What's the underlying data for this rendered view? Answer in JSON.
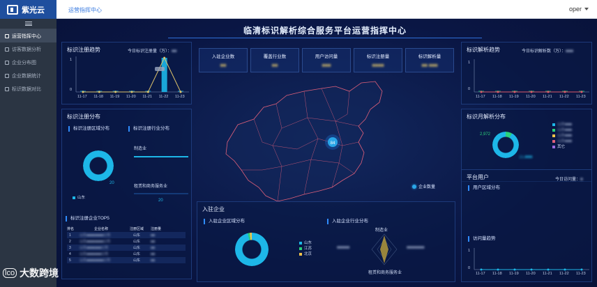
{
  "header": {
    "brand": "紫光云",
    "breadcrumb": "运营指挥中心",
    "user": "oper"
  },
  "sidebar": {
    "items": [
      {
        "label": "运营指挥中心",
        "active": true
      },
      {
        "label": "访客数据分析",
        "active": false
      },
      {
        "label": "企业分布图",
        "active": false
      },
      {
        "label": "企业数据统计",
        "active": false
      },
      {
        "label": "标识数据对比",
        "active": false
      }
    ]
  },
  "dashboard": {
    "title": "临清标识解析综合服务平台运营指挥中心",
    "stats": [
      {
        "label": "入驻企业数",
        "value": "■■"
      },
      {
        "label": "覆盖行业数",
        "value": "■■"
      },
      {
        "label": "用户访问量",
        "value": "■■■"
      },
      {
        "label": "标识注册量",
        "value": "■■■■"
      },
      {
        "label": "标识解析量",
        "value": "■■ ■■■"
      }
    ],
    "reg_trend": {
      "title": "标识注册趋势",
      "today_label": "今日标识注册量（万）：",
      "today_value": "■■",
      "y_ticks": [
        "1",
        "0"
      ],
      "peak_label": "■■■"
    },
    "resolve_trend": {
      "title": "标识解析趋势",
      "today_label": "今日标识解析数（万）：",
      "today_value": "■■■",
      "y_ticks": [
        "1",
        "0"
      ]
    },
    "reg_dist": {
      "title": "标识注册分布",
      "region_label": "标识注册区域分布",
      "industry_label": "标识注册行业分布",
      "region_value": "20",
      "region_legend": "山东",
      "industry_1": "制造业",
      "industry_2": "租赁和商务服务业",
      "industry_2_value": "20"
    },
    "top5": {
      "title": "标识注册企业TOP5",
      "headers": [
        "排名",
        "企业名称",
        "注册区域",
        "注册量"
      ],
      "rows": [
        {
          "rank": "1",
          "name": "山东■■■■■■■■公司",
          "region": "山东",
          "count": "■■"
        },
        {
          "rank": "2",
          "name": "山东■■■■■■■■公司",
          "region": "山东",
          "count": "■■"
        },
        {
          "rank": "3",
          "name": "山东■■■■■■■公司",
          "region": "山东",
          "count": "■■"
        },
        {
          "rank": "4",
          "name": "山东■■■■■■■公司",
          "region": "山东",
          "count": "■■"
        },
        {
          "rank": "5",
          "name": "山东■■■■■■■■公司",
          "region": "山东",
          "count": "■■"
        }
      ]
    },
    "map": {
      "marker_value": "84",
      "legend": "企业数量"
    },
    "enterprises": {
      "title": "入驻企业",
      "region_label": "入驻企业区域分布",
      "industry_label": "入驻企业行业分布",
      "region_legend": [
        "山东",
        "江苏",
        "北京"
      ],
      "radar_top": "制造业",
      "radar_bottom": "租赁和商务服务业"
    },
    "monthly_resolve": {
      "title": "标识月解析分布",
      "values": [
        "2,972",
        "15,■■■"
      ],
      "legend": [
        "山东■■■",
        "山东■■■",
        "山东■■■",
        "山东■■■",
        "其它"
      ]
    },
    "platform_users": {
      "title": "平台用户",
      "today_label": "今日访问量：",
      "region_label": "用户区域分布",
      "visit_trend_label": "访问量趋势",
      "y_ticks": [
        "1",
        "0"
      ]
    },
    "dates": [
      "11-17",
      "11-18",
      "11-19",
      "11-20",
      "11-21",
      "11-22",
      "11-23"
    ]
  },
  "watermark": {
    "icon": "lco",
    "text": "大数跨境"
  },
  "chart_data": [
    {
      "type": "bar",
      "title": "标识注册趋势",
      "categories": [
        "11-17",
        "11-18",
        "11-19",
        "11-20",
        "11-21",
        "11-22",
        "11-23"
      ],
      "values": [
        0,
        0,
        0,
        0,
        0,
        1,
        0
      ],
      "ylim": [
        0,
        1
      ]
    },
    {
      "type": "line",
      "title": "标识注册趋势",
      "categories": [
        "11-17",
        "11-18",
        "11-19",
        "11-20",
        "11-21",
        "11-22",
        "11-23"
      ],
      "values": [
        0,
        0,
        0,
        0,
        0,
        1,
        0
      ],
      "ylim": [
        0,
        1
      ]
    },
    {
      "type": "bar",
      "title": "标识解析趋势",
      "categories": [
        "11-17",
        "11-18",
        "11-19",
        "11-20",
        "11-21",
        "11-22",
        "11-23"
      ],
      "values": [
        0,
        0,
        0,
        0,
        0,
        0,
        0
      ],
      "ylim": [
        0,
        1
      ]
    },
    {
      "type": "line",
      "title": "访问量趋势",
      "categories": [
        "11-17",
        "11-18",
        "11-19",
        "11-20",
        "11-21",
        "11-22",
        "11-23"
      ],
      "values": [
        0,
        0,
        0,
        0,
        0,
        0,
        0
      ],
      "ylim": [
        0,
        1
      ]
    }
  ],
  "colors": {
    "accent": "#2aa6e8",
    "panel_border": "#1d3a7a",
    "bar": "#1db7e8",
    "line": "#e0c46a"
  }
}
